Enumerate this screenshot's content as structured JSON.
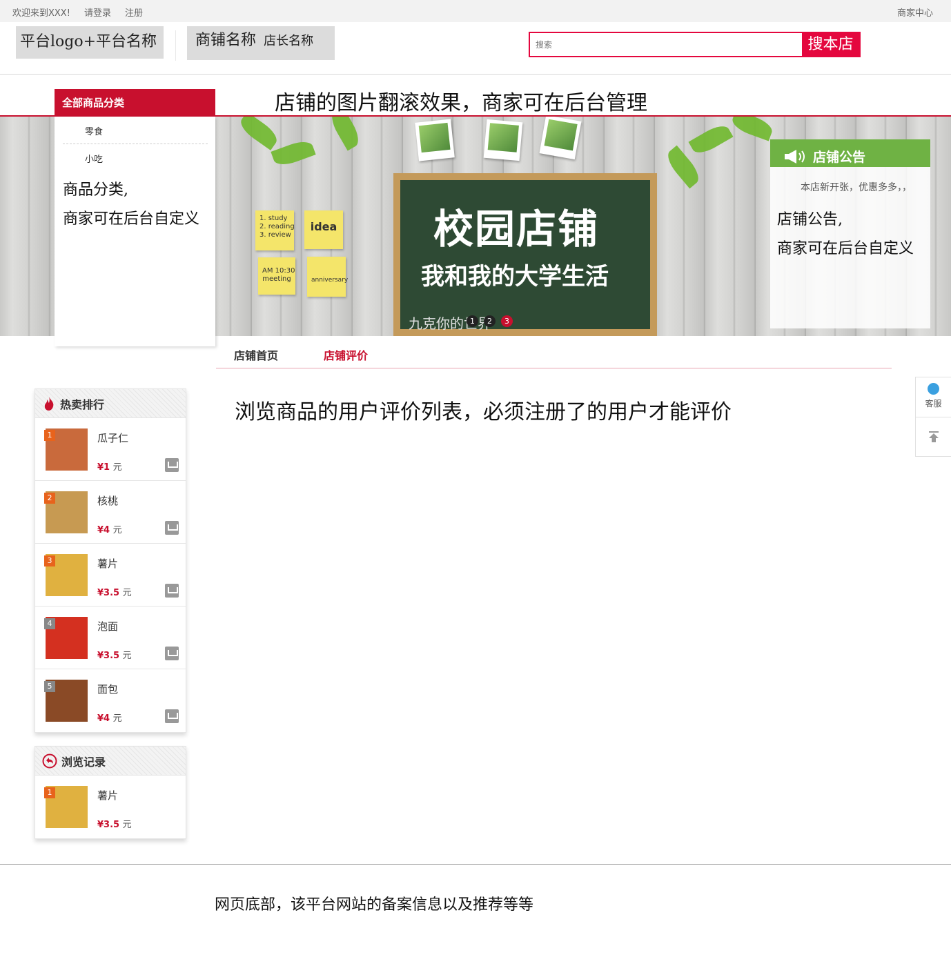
{
  "topbar": {
    "welcome": "欢迎来到XXX!",
    "login": "请登录",
    "register": "注册",
    "merchant_center": "商家中心"
  },
  "header": {
    "logo_text": "平台logo+平台名称",
    "shop_name": "商铺名称",
    "owner_name": "店长名称",
    "search_placeholder": "搜索",
    "search_button": "搜本店"
  },
  "category": {
    "header": "全部商品分类",
    "items": [
      "零食",
      "小吃"
    ],
    "note_line1": "商品分类,",
    "note_line2": "商家可在后台自定义"
  },
  "banner": {
    "title": "店铺的图片翻滚效果，商家可在后台管理",
    "board_line1": "校园店铺",
    "board_line2": "我和我的大学生活",
    "board_line3": "九克你的世界",
    "notes": [
      "1. study\n2. reading\n3. review",
      "idea",
      "AM 10:30\nmeeting",
      "anniversary"
    ],
    "dots": [
      "1",
      "2",
      "3"
    ],
    "active_dot": 3
  },
  "notice": {
    "title": "店铺公告",
    "text": "本店新开张，优惠多多，，",
    "note_line1": "店铺公告,",
    "note_line2": "商家可在后台自定义"
  },
  "tabs": [
    {
      "label": "店铺首页",
      "active": false
    },
    {
      "label": "店铺评价",
      "active": true
    }
  ],
  "review_note": "浏览商品的用户评价列表，必须注册了的用户才能评价",
  "hot": {
    "title": "热卖排行",
    "items": [
      {
        "rank": "1",
        "name": "瓜子仁",
        "price": "¥1",
        "unit": "元",
        "img_color": "#c96a3c"
      },
      {
        "rank": "2",
        "name": "核桃",
        "price": "¥4",
        "unit": "元",
        "img_color": "#c79a52"
      },
      {
        "rank": "3",
        "name": "薯片",
        "price": "¥3.5",
        "unit": "元",
        "img_color": "#e0b140"
      },
      {
        "rank": "4",
        "name": "泡面",
        "price": "¥3.5",
        "unit": "元",
        "img_color": "#d43020"
      },
      {
        "rank": "5",
        "name": "面包",
        "price": "¥4",
        "unit": "元",
        "img_color": "#8a4a26"
      }
    ]
  },
  "history": {
    "title": "浏览记录",
    "items": [
      {
        "rank": "1",
        "name": "薯片",
        "price": "¥3.5",
        "unit": "元",
        "img_color": "#e0b140"
      }
    ]
  },
  "float": {
    "service": "客服"
  },
  "footer": "网页底部，该平台网站的备案信息以及推荐等等",
  "colors": {
    "brand_red": "#c8102e",
    "search_red": "#e4073e",
    "notice_green": "#6fb244"
  }
}
